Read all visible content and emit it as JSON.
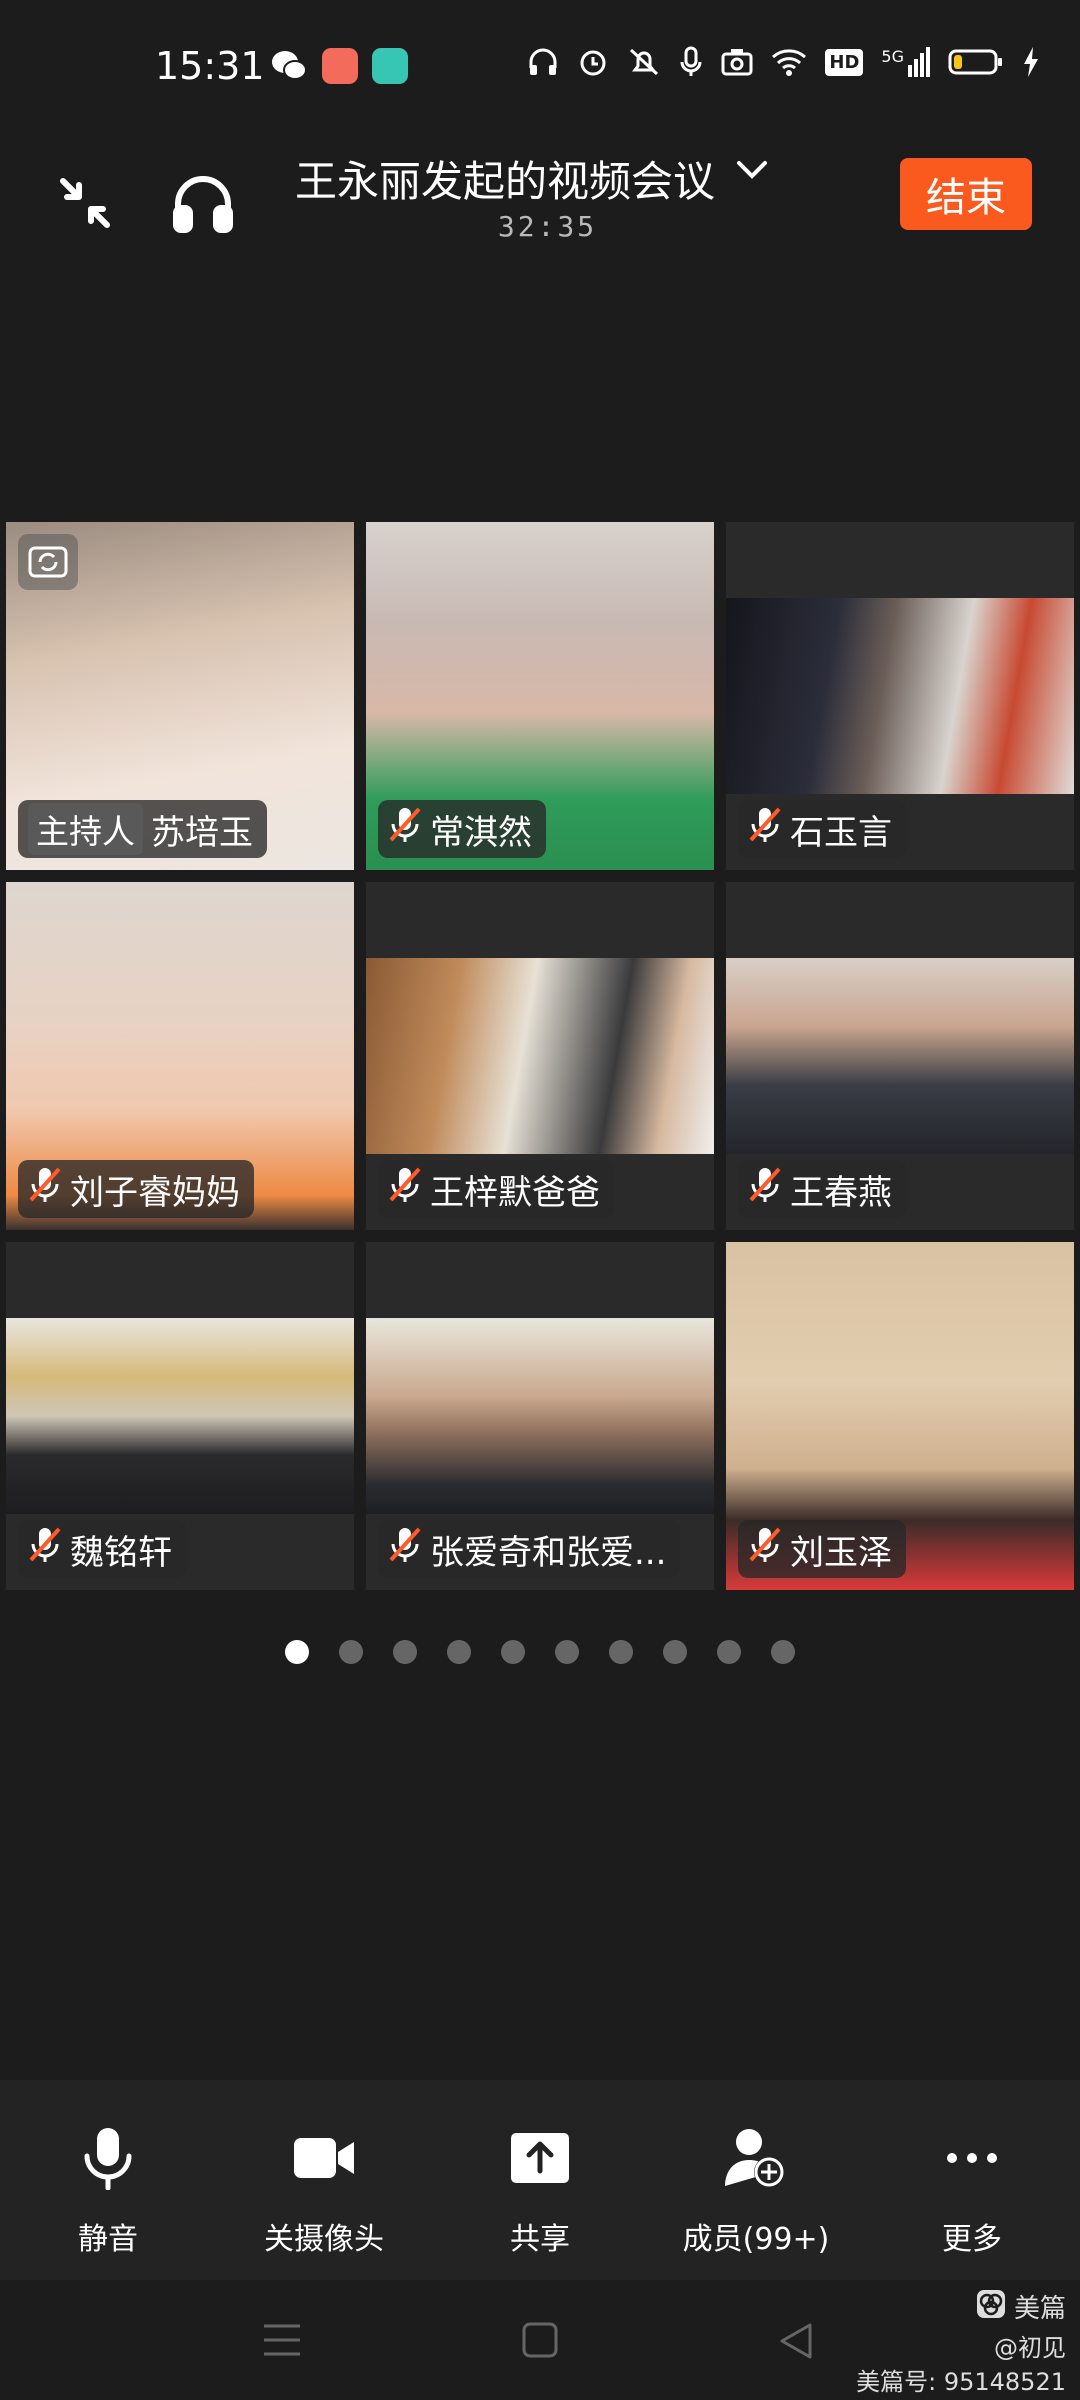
{
  "status": {
    "time": "15:31",
    "app_icons": [
      "wechat-icon",
      "app-icon",
      "chat-app-icon"
    ],
    "system_icons": [
      "headphones-icon",
      "alarm-icon",
      "mute-bell-icon",
      "mic-icon",
      "camera-icon",
      "wifi-icon",
      "hd-icon",
      "signal-5g-icon",
      "battery-icon",
      "charging-icon"
    ],
    "hd_label": "HD",
    "network_label": "5G"
  },
  "header": {
    "title": "王永丽发起的视频会议",
    "timer": "32:35",
    "end_label": "结束"
  },
  "participants": [
    {
      "host_label": "主持人",
      "name": "苏培玉",
      "muted": false
    },
    {
      "name": "常淇然",
      "muted": true
    },
    {
      "name": "石玉言",
      "muted": true
    },
    {
      "name": "刘子睿妈妈",
      "muted": true
    },
    {
      "name": "王梓默爸爸",
      "muted": true
    },
    {
      "name": "王春燕",
      "muted": true
    },
    {
      "name": "魏铭轩",
      "muted": true
    },
    {
      "name": "张爱奇和张爱...",
      "muted": true
    },
    {
      "name": "刘玉泽",
      "muted": true
    }
  ],
  "pagination": {
    "total": 10,
    "current": 1
  },
  "toolbar": {
    "mute_label": "静音",
    "camera_label": "关摄像头",
    "share_label": "共享",
    "members_label": "成员(99+)",
    "more_label": "更多"
  },
  "watermark": {
    "brand": "美篇",
    "author": "@初见",
    "id_label": "美篇号: 95148521"
  },
  "colors": {
    "background": "#1c1c1d",
    "end_button": "#fa5a1e",
    "muted_mic": "#ff5a2a"
  }
}
